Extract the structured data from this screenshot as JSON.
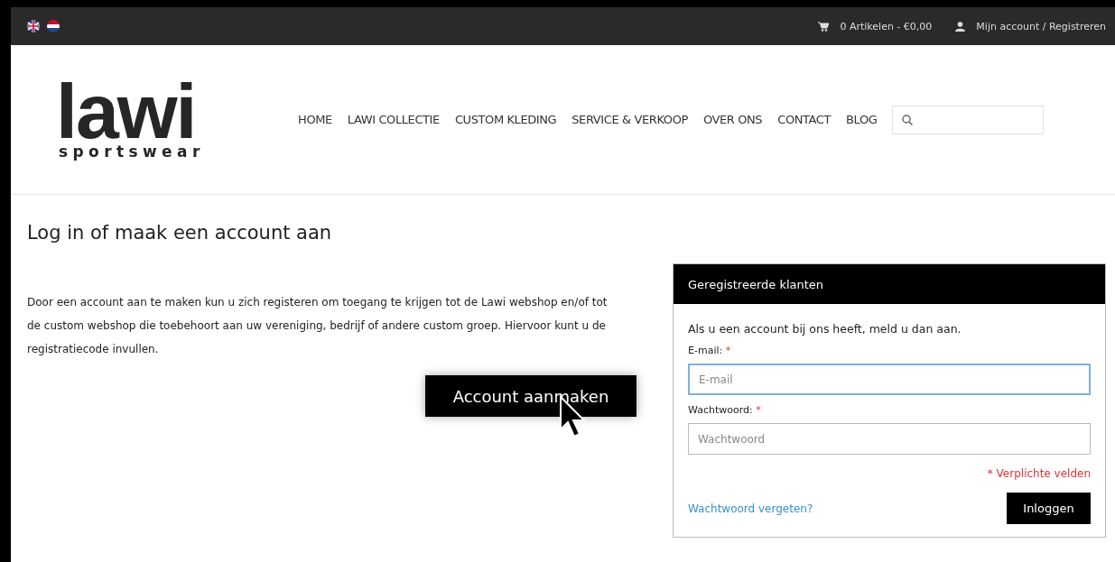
{
  "topbar": {
    "cart": "0 Artikelen - €0,00",
    "account": "Mijn account / Registreren"
  },
  "logo": {
    "word": "lawi",
    "tagline": "sportswear"
  },
  "nav": [
    "HOME",
    "LAWI COLLECTIE",
    "CUSTOM KLEDING",
    "SERVICE & VERKOOP",
    "OVER ONS",
    "CONTACT",
    "BLOG"
  ],
  "heading": "Log in of maak een account aan",
  "intro": "Door een account aan te maken kun u zich registeren om toegang te krijgen tot de Lawi webshop en/of tot de custom webshop die toebehoort aan uw vereniging, bedrijf of andere custom groep. Hiervoor kunt u de registratiecode invullen.",
  "create_button": "Account aanmaken",
  "login": {
    "title": "Geregistreerde klanten",
    "text": "Als u een account bij ons heeft, meld u dan aan.",
    "fields": [
      {
        "label": "E-mail:",
        "required": "*",
        "placeholder": "E-mail",
        "focused": true
      },
      {
        "label": "Wachtwoord:",
        "required": "*",
        "placeholder": "Wachtwoord",
        "focused": false
      }
    ],
    "required_note": "* Verplichte velden",
    "forgot": "Wachtwoord vergeten?",
    "submit": "Inloggen"
  }
}
